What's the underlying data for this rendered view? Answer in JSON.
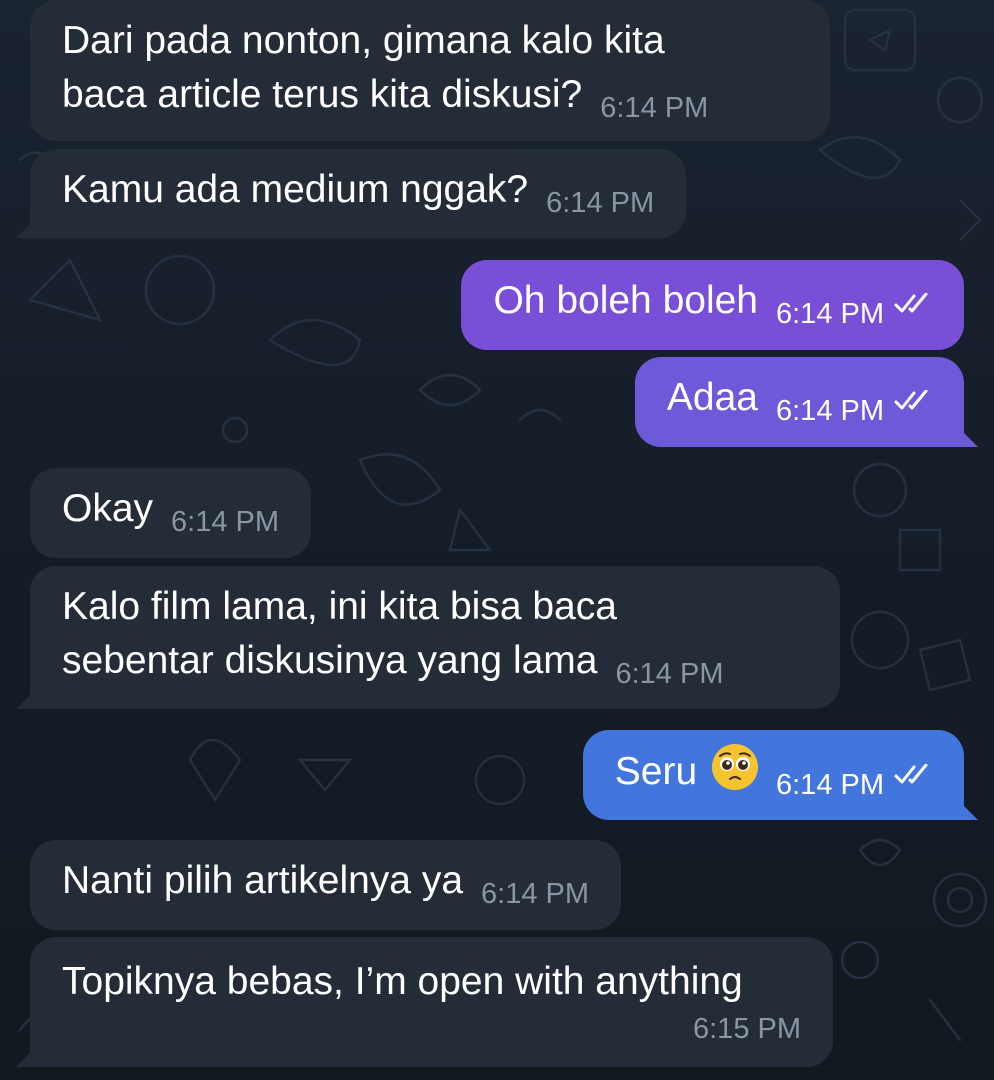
{
  "messages": [
    {
      "id": 1,
      "direction": "incoming",
      "text_lines": [
        "Dari pada nonton, gimana kalo kita",
        "baca article terus kita diskusi?"
      ],
      "time": "6:14 PM"
    },
    {
      "id": 2,
      "direction": "incoming",
      "text": "Kamu ada medium nggak?",
      "time": "6:14 PM"
    },
    {
      "id": 3,
      "direction": "outgoing",
      "text": "Oh boleh boleh",
      "time": "6:14 PM",
      "status": "read"
    },
    {
      "id": 4,
      "direction": "outgoing",
      "text": "Adaa",
      "time": "6:14 PM",
      "status": "read"
    },
    {
      "id": 5,
      "direction": "incoming",
      "text": "Okay",
      "time": "6:14 PM"
    },
    {
      "id": 6,
      "direction": "incoming",
      "text_lines": [
        "Kalo film lama, ini kita bisa baca",
        "sebentar diskusinya yang lama"
      ],
      "time": "6:14 PM"
    },
    {
      "id": 7,
      "direction": "outgoing",
      "text": "Seru",
      "emoji": "pleading-face",
      "time": "6:14 PM",
      "status": "read"
    },
    {
      "id": 8,
      "direction": "incoming",
      "text": "Nanti pilih artikelnya ya",
      "time": "6:14 PM"
    },
    {
      "id": 9,
      "direction": "incoming",
      "text": "Topiknya bebas, I’m open with anything",
      "time": "6:15 PM"
    }
  ],
  "colors": {
    "background": "#141c27",
    "incoming_bubble": "#232c37",
    "outgoing_bubble_top": "#7a4fd8",
    "outgoing_bubble_bottom": "#4276dc",
    "timestamp_incoming": "#8a96a4"
  },
  "icons": {
    "read_receipt": "double-check-icon",
    "emoji": "pleading-face-emoji"
  }
}
